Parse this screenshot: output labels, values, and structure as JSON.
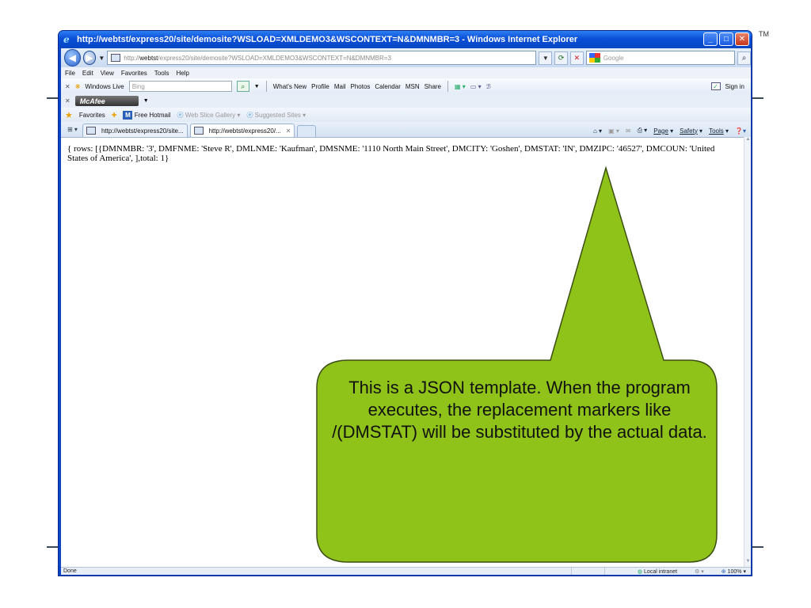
{
  "slide": {
    "trademark": "TM"
  },
  "window": {
    "title": "http://webtst/express20/site/demosite?WSLOAD=XMLDEMO3&WSCONTEXT=N&DMNMBR=3 - Windows Internet Explorer",
    "controls": {
      "minimize": "_",
      "maximize": "□",
      "close": "✕"
    }
  },
  "address": {
    "url_prefix": "http://",
    "url_host": "webtst",
    "url_rest": "/express20/site/demosite?WSLOAD=XMLDEMO3&WSCONTEXT=N&DMNMBR=3",
    "search_placeholder": "Google"
  },
  "menu": [
    "File",
    "Edit",
    "View",
    "Favorites",
    "Tools",
    "Help"
  ],
  "windows_live": {
    "label": "Windows Live",
    "search_placeholder": "Bing",
    "links": [
      "What's New",
      "Profile",
      "Mail",
      "Photos",
      "Calendar",
      "MSN",
      "Share"
    ],
    "sign_in": "Sign in"
  },
  "mcafee": {
    "label": "McAfee"
  },
  "favorites": {
    "label": "Favorites",
    "items": [
      "Free Hotmail",
      "Web Slice Gallery",
      "Suggested Sites"
    ]
  },
  "tabs": [
    {
      "label": "http://webtst/express20/site..."
    },
    {
      "label": "http://webtst/express20/..."
    }
  ],
  "commandbar": {
    "page": "Page",
    "safety": "Safety",
    "tools": "Tools"
  },
  "content": {
    "json_text": "{ rows: [{DMNMBR: '3', DMFNME: 'Steve R', DMLNME: 'Kaufman', DMSNME: '1110 North Main Street', DMCITY: 'Goshen', DMSTAT: 'IN', DMZIPC: '46527', DMCOUN: 'United States of America', ],total: 1}"
  },
  "status": {
    "left": "Done",
    "zone": "Local intranet",
    "zoom": "100%"
  },
  "callout": {
    "text": "This is a JSON template. When the program executes, the replacement markers like /(DMSTAT) will be substituted by the actual data.",
    "fill_color": "#8fc31a",
    "stroke_color": "#3c4f12"
  }
}
